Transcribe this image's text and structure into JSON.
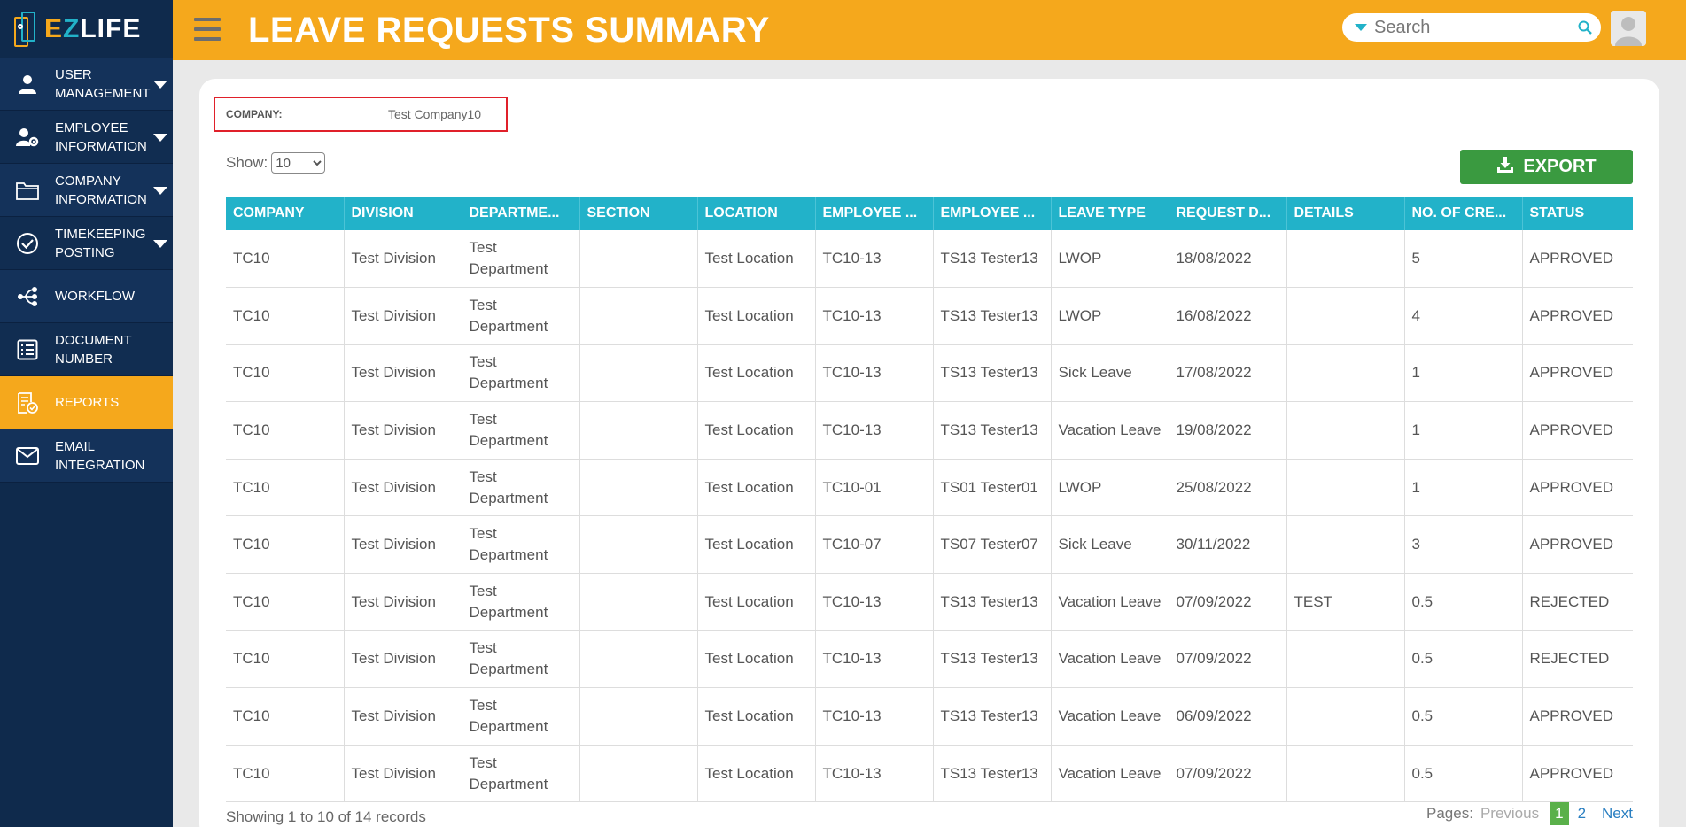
{
  "app": {
    "logo_text_e": "E",
    "logo_text_z": "Z",
    "logo_text_rest": "LIFE"
  },
  "sidebar": {
    "items": [
      {
        "label": "User Management",
        "icon": "user-icon",
        "has_caret": true
      },
      {
        "label": "Employee Information",
        "icon": "user-gear-icon",
        "has_caret": true
      },
      {
        "label": "Company Information",
        "icon": "folder-icon",
        "has_caret": true
      },
      {
        "label": "Timekeeping Posting",
        "icon": "check-circle-icon",
        "has_caret": true
      },
      {
        "label": "Workflow",
        "icon": "workflow-icon",
        "has_caret": false
      },
      {
        "label": "Document Number",
        "icon": "list-icon",
        "has_caret": false
      },
      {
        "label": "Reports",
        "icon": "report-icon",
        "has_caret": false,
        "active": true
      },
      {
        "label": "Email Integration",
        "icon": "envelope-icon",
        "has_caret": false
      }
    ]
  },
  "header": {
    "title": "LEAVE REQUESTS SUMMARY",
    "search_placeholder": "Search"
  },
  "filters": {
    "company_label": "COMPANY:",
    "company_value": "Test Company10",
    "show_label": "Show:",
    "show_value": "10"
  },
  "export_label": "EXPORT",
  "table": {
    "columns": [
      "COMPANY",
      "DIVISION",
      "DEPARTME...",
      "SECTION",
      "LOCATION",
      "EMPLOYEE ...",
      "EMPLOYEE ...",
      "LEAVE TYPE",
      "REQUEST D...",
      "DETAILS",
      "NO. OF CRE...",
      "STATUS"
    ],
    "rows": [
      [
        "TC10",
        "Test Division",
        "Test Department",
        "",
        "Test Location",
        "TC10-13",
        "TS13 Tester13",
        "LWOP",
        "18/08/2022",
        "",
        "5",
        "APPROVED"
      ],
      [
        "TC10",
        "Test Division",
        "Test Department",
        "",
        "Test Location",
        "TC10-13",
        "TS13 Tester13",
        "LWOP",
        "16/08/2022",
        "",
        "4",
        "APPROVED"
      ],
      [
        "TC10",
        "Test Division",
        "Test Department",
        "",
        "Test Location",
        "TC10-13",
        "TS13 Tester13",
        "Sick Leave",
        "17/08/2022",
        "",
        "1",
        "APPROVED"
      ],
      [
        "TC10",
        "Test Division",
        "Test Department",
        "",
        "Test Location",
        "TC10-13",
        "TS13 Tester13",
        "Vacation Leave",
        "19/08/2022",
        "",
        "1",
        "APPROVED"
      ],
      [
        "TC10",
        "Test Division",
        "Test Department",
        "",
        "Test Location",
        "TC10-01",
        "TS01 Tester01",
        "LWOP",
        "25/08/2022",
        "",
        "1",
        "APPROVED"
      ],
      [
        "TC10",
        "Test Division",
        "Test Department",
        "",
        "Test Location",
        "TC10-07",
        "TS07 Tester07",
        "Sick Leave",
        "30/11/2022",
        "",
        "3",
        "APPROVED"
      ],
      [
        "TC10",
        "Test Division",
        "Test Department",
        "",
        "Test Location",
        "TC10-13",
        "TS13 Tester13",
        "Vacation Leave",
        "07/09/2022",
        "TEST",
        "0.5",
        "REJECTED"
      ],
      [
        "TC10",
        "Test Division",
        "Test Department",
        "",
        "Test Location",
        "TC10-13",
        "TS13 Tester13",
        "Vacation Leave",
        "07/09/2022",
        "",
        "0.5",
        "REJECTED"
      ],
      [
        "TC10",
        "Test Division",
        "Test Department",
        "",
        "Test Location",
        "TC10-13",
        "TS13 Tester13",
        "Vacation Leave",
        "06/09/2022",
        "",
        "0.5",
        "APPROVED"
      ],
      [
        "TC10",
        "Test Division",
        "Test Department",
        "",
        "Test Location",
        "TC10-13",
        "TS13 Tester13",
        "Vacation Leave",
        "07/09/2022",
        "",
        "0.5",
        "APPROVED"
      ]
    ]
  },
  "footer": {
    "showing": "Showing 1 to 10 of 14 records",
    "pages_label": "Pages:",
    "previous": "Previous",
    "pages": [
      "1",
      "2"
    ],
    "current_page": "1",
    "next": "Next"
  },
  "colors": {
    "accent_orange": "#f5a81c",
    "sidebar_navy": "#0f2a4c",
    "table_header_teal": "#22b2c9",
    "export_green": "#3a9a40"
  }
}
